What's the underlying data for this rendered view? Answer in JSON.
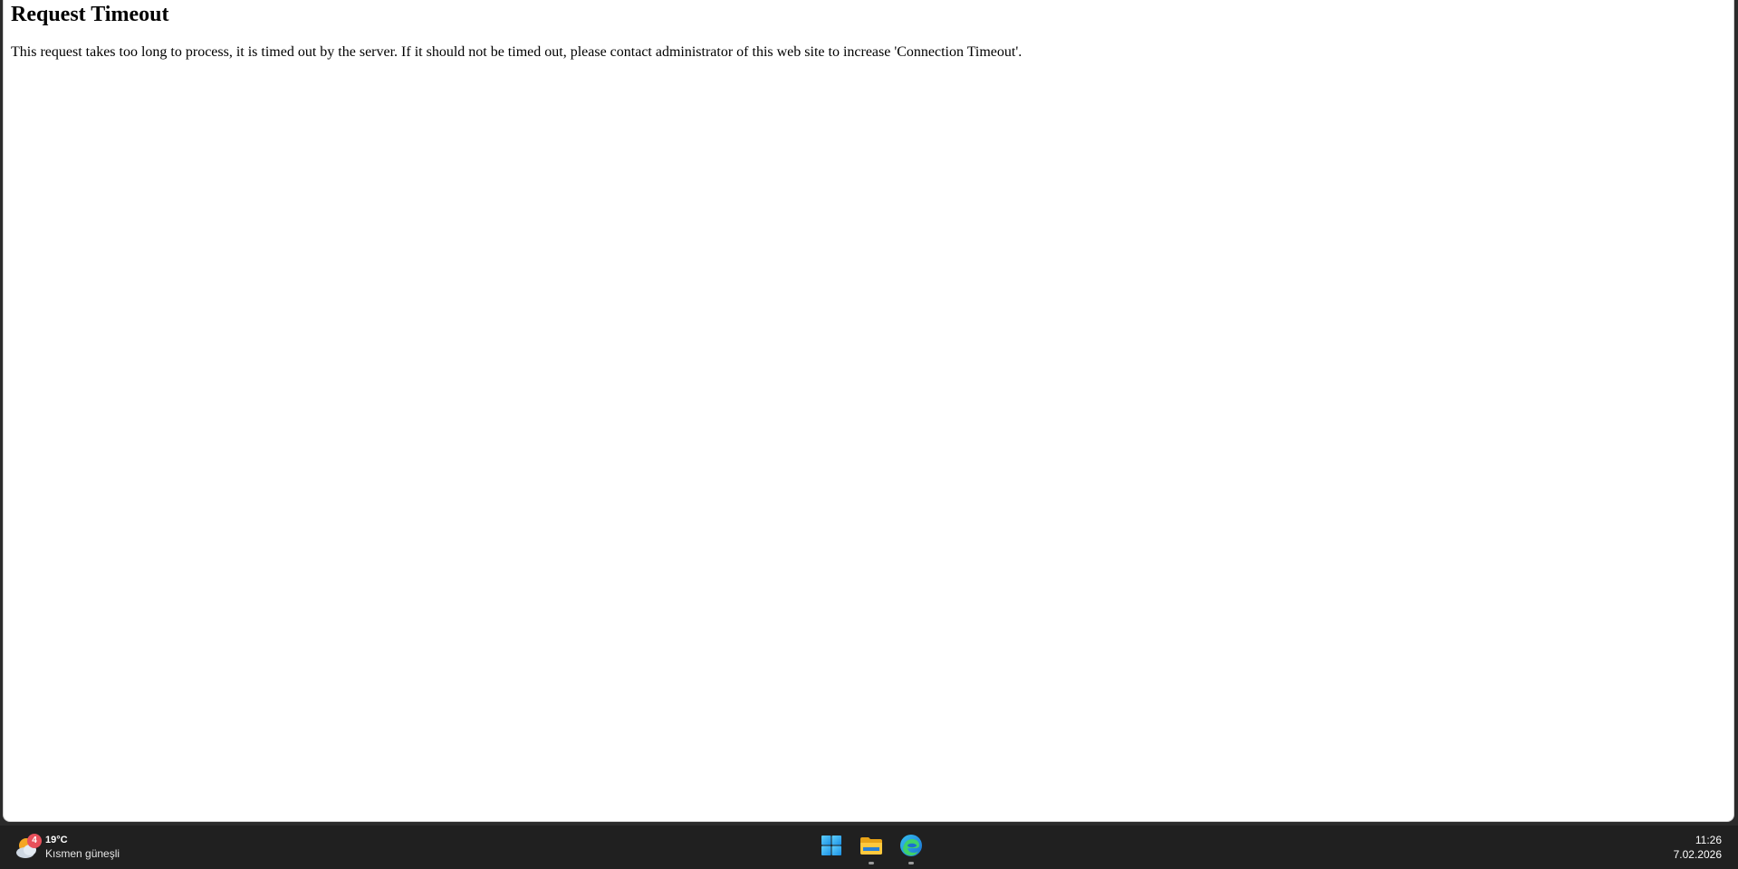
{
  "page": {
    "heading": "Request Timeout",
    "message": "This request takes too long to process, it is timed out by the server. If it should not be timed out, please contact administrator of this web site to increase 'Connection Timeout'."
  },
  "taskbar": {
    "weather": {
      "badge": "4",
      "temperature": "19°C",
      "description": "Kısmen güneşli",
      "icon": "partly-sunny-icon"
    },
    "apps": [
      {
        "name": "start",
        "icon": "windows-start-icon"
      },
      {
        "name": "file-explorer",
        "icon": "folder-icon"
      },
      {
        "name": "edge",
        "icon": "edge-browser-icon"
      }
    ],
    "clock": {
      "time": "11:26",
      "date": "7.02.2026"
    }
  },
  "colors": {
    "taskbar_bg": "#202020",
    "page_bg": "#ffffff",
    "badge": "#e8505b"
  }
}
